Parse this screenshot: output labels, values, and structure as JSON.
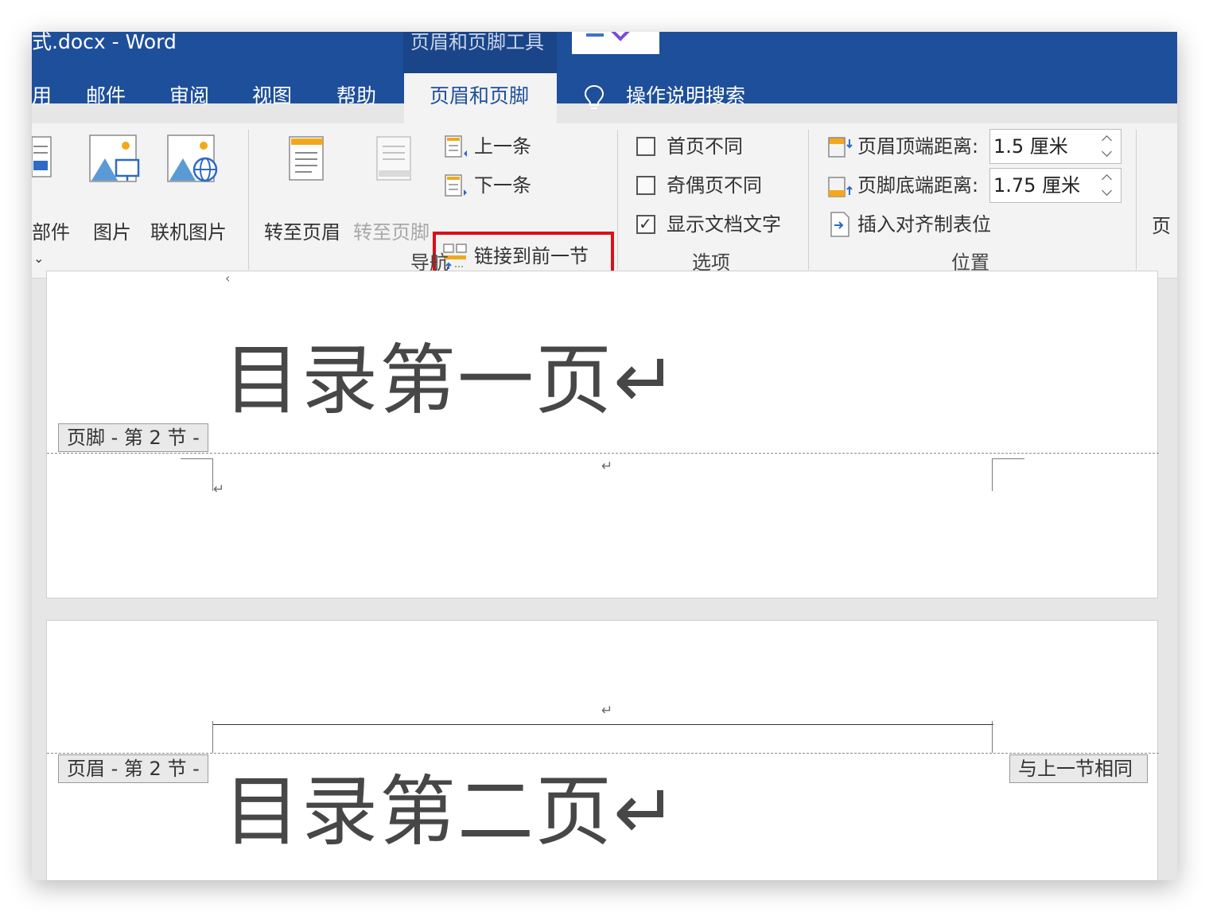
{
  "titlebar": {
    "doc_title": "式.docx - Word",
    "context_title": "页眉和页脚工具"
  },
  "tabs": [
    "用",
    "邮件",
    "审阅",
    "视图",
    "帮助"
  ],
  "active_tab": "页眉和页脚",
  "tell_me": "操作说明搜索",
  "ribbon": {
    "insert": {
      "parts": "部件",
      "picture": "图片",
      "online_picture": "联机图片"
    },
    "navigation": {
      "goto_header": "转至页眉",
      "goto_footer": "转至页脚",
      "previous": "上一条",
      "next": "下一条",
      "link_previous": "链接到前一节",
      "group_label": "导航"
    },
    "options": {
      "different_first": {
        "label": "首页不同",
        "checked": false
      },
      "different_odd_even": {
        "label": "奇偶页不同",
        "checked": false
      },
      "show_document_text": {
        "label": "显示文档文字",
        "checked": true,
        "mark": "✓"
      },
      "group_label": "选项"
    },
    "position": {
      "header_from_top_label": "页眉顶端距离:",
      "header_from_top_value": "1.5 厘米",
      "footer_from_bottom_label": "页脚底端距离:",
      "footer_from_bottom_value": "1.75 厘米",
      "insert_alignment_tab": "插入对齐制表位",
      "group_label": "位置"
    },
    "close_partial": "页"
  },
  "document": {
    "page1_text": "目录第一页↵",
    "footer_tag": "页脚 - 第 2 节 -",
    "page2_text": "目录第二页↵",
    "header_tag": "页眉 - 第 2 节 -",
    "same_as_previous": "与上一节相同",
    "paragraph_mark": "↵"
  },
  "colors": {
    "title_bar": "#1e4f9a",
    "ribbon_bg": "#f3f3f3",
    "highlight_box": "#d9101a",
    "doc_background": "#e6e6e6"
  }
}
